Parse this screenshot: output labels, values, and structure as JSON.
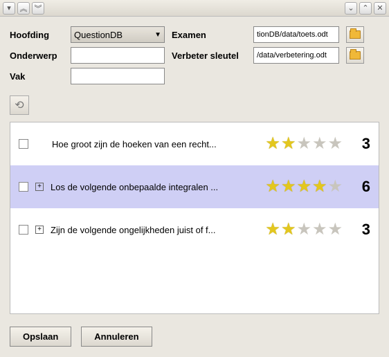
{
  "titlebar": {
    "expand_up": "︽",
    "expand_down": "︾",
    "min": "⌄",
    "max": "⌃",
    "close": "✕"
  },
  "form": {
    "hoofding_label": "Hoofding",
    "hoofding_value": "QuestionDB",
    "onderwerp_label": "Onderwerp",
    "onderwerp_value": "",
    "vak_label": "Vak",
    "vak_value": "",
    "examen_label": "Examen",
    "examen_value": "tionDB/data/toets.odt",
    "verbeter_label": "Verbeter sleutel",
    "verbeter_value": "/data/verbetering.odt"
  },
  "rows": [
    {
      "text": "Hoe groot zijn de hoeken van een recht...",
      "stars": 2,
      "count": "3",
      "expandable": false
    },
    {
      "text": "Los de volgende onbepaalde integralen ...",
      "stars": 4,
      "count": "6",
      "expandable": true
    },
    {
      "text": "Zijn de volgende ongelijkheden juist of f...",
      "stars": 2,
      "count": "3",
      "expandable": true
    }
  ],
  "footer": {
    "save": "Opslaan",
    "cancel": "Annuleren"
  }
}
